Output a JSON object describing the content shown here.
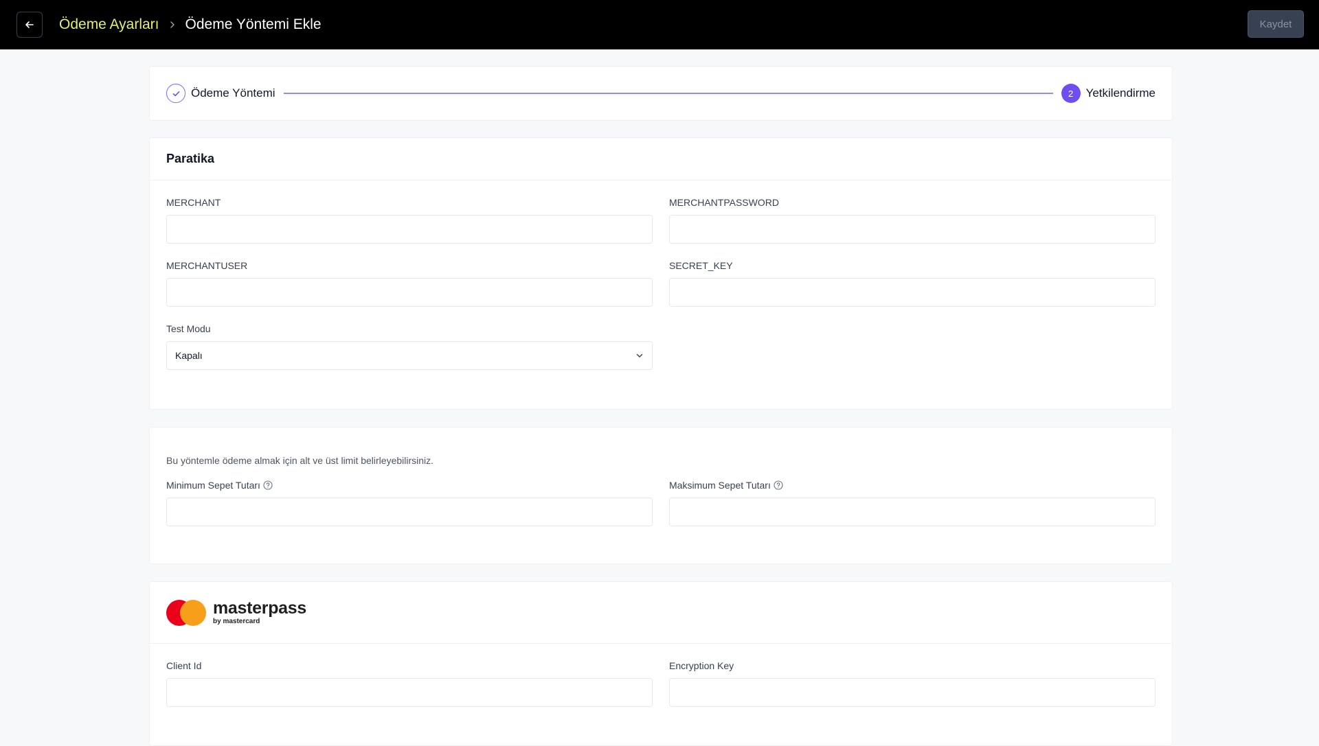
{
  "header": {
    "breadcrumb_parent": "Ödeme Ayarları",
    "breadcrumb_current": "Ödeme Yöntemi Ekle",
    "save_label": "Kaydet"
  },
  "stepper": {
    "step1_label": "Ödeme Yöntemi",
    "step2_number": "2",
    "step2_label": "Yetkilendirme"
  },
  "paratika": {
    "title": "Paratika",
    "merchant_label": "MERCHANT",
    "merchant_value": "",
    "merchantpassword_label": "MERCHANTPASSWORD",
    "merchantpassword_value": "",
    "merchantuser_label": "MERCHANTUSER",
    "merchantuser_value": "",
    "secret_key_label": "SECRET_KEY",
    "secret_key_value": "",
    "test_mode_label": "Test Modu",
    "test_mode_value": "Kapalı"
  },
  "limits": {
    "help_text": "Bu yöntemle ödeme almak için alt ve üst limit belirleyebilirsiniz.",
    "min_label": "Minimum Sepet Tutarı",
    "min_value": "",
    "max_label": "Maksimum Sepet Tutarı",
    "max_value": ""
  },
  "masterpass": {
    "logo_word": "masterpass",
    "logo_by": "by mastercard",
    "client_id_label": "Client Id",
    "client_id_value": "",
    "encryption_key_label": "Encryption Key",
    "encryption_key_value": ""
  },
  "colors": {
    "accent": "#6d4ef2",
    "breadcrumb_link": "#e5f06b",
    "topbar_bg": "#000000"
  }
}
